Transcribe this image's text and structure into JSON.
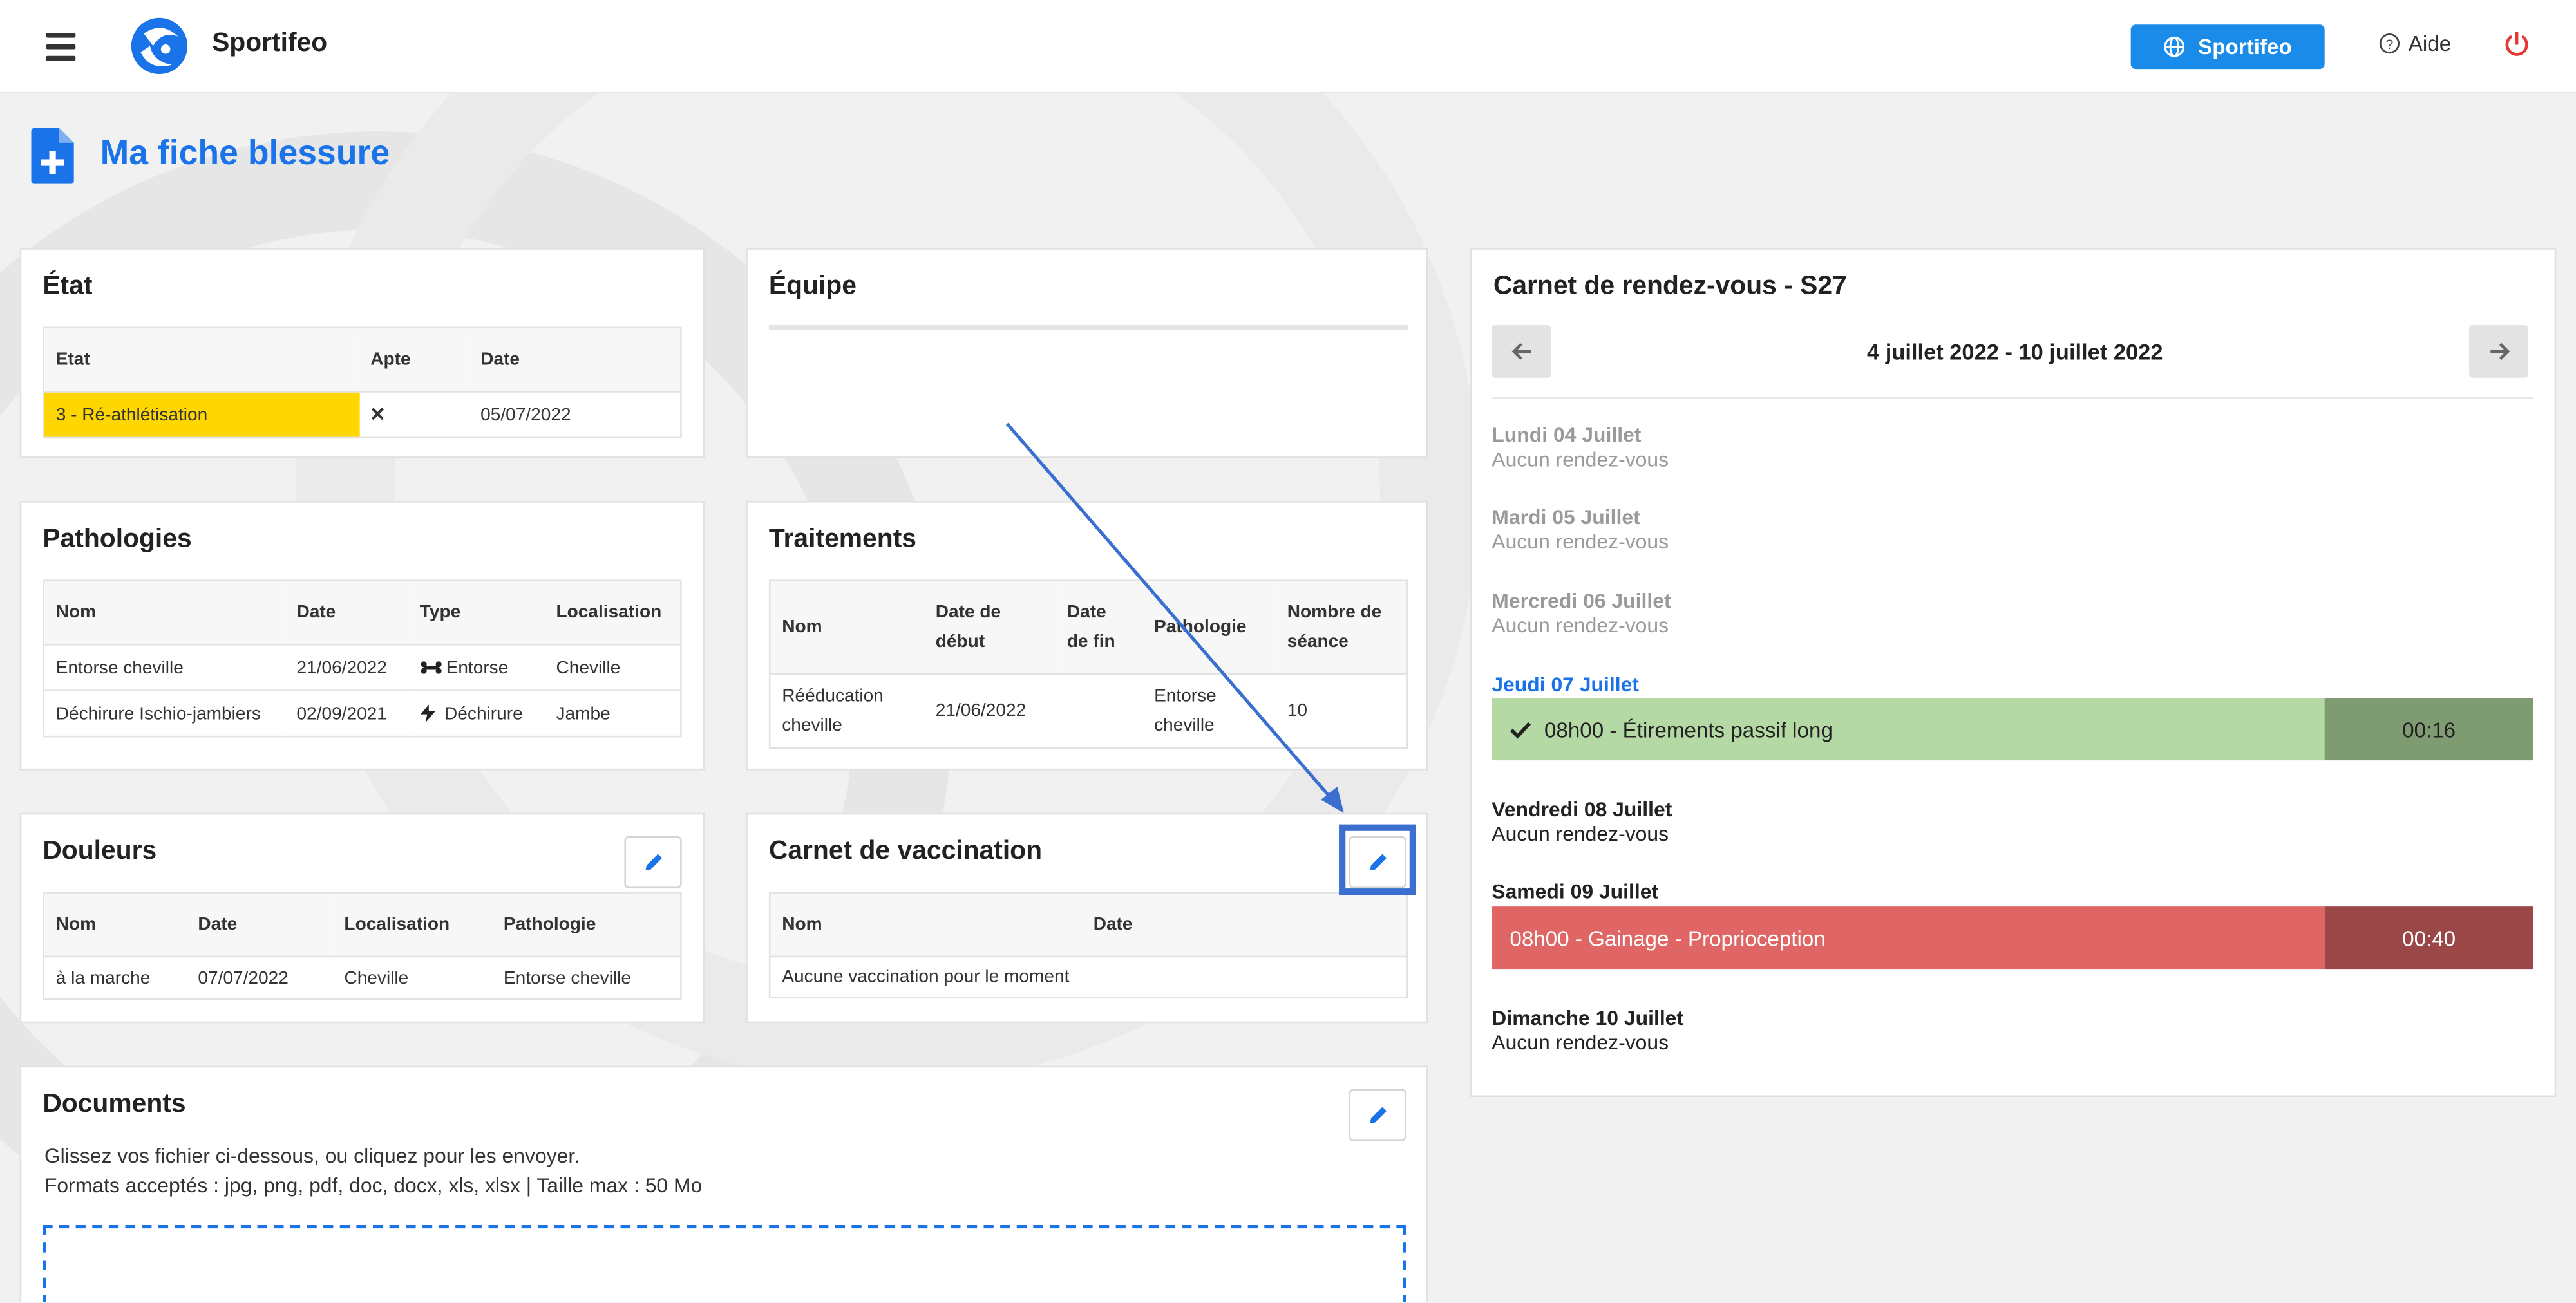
{
  "topbar": {
    "brand": "Sportifeo",
    "sportifeo_button": "Sportifeo",
    "help_label": "Aide"
  },
  "page": {
    "title": "Ma fiche blessure"
  },
  "etat": {
    "title": "État",
    "headers": [
      "Etat",
      "Apte",
      "Date"
    ],
    "row": {
      "etat": "3 - Ré-athlétisation",
      "apte": "×",
      "date": "05/07/2022",
      "highlight_color": "#ffd700"
    }
  },
  "equipe": {
    "title": "Équipe"
  },
  "pathologies": {
    "title": "Pathologies",
    "headers": [
      "Nom",
      "Date",
      "Type",
      "Localisation"
    ],
    "rows": [
      {
        "nom": "Entorse cheville",
        "date": "21/06/2022",
        "type": "Entorse",
        "type_icon": "bone-icon",
        "localisation": "Cheville"
      },
      {
        "nom": "Déchirure Ischio-jambiers",
        "date": "02/09/2021",
        "type": "Déchirure",
        "type_icon": "lightning-icon",
        "localisation": "Jambe"
      }
    ]
  },
  "traitements": {
    "title": "Traitements",
    "headers": [
      "Nom",
      "Date de début",
      "Date de fin",
      "Pathologie",
      "Nombre de séance"
    ],
    "rows": [
      {
        "nom": "Rééducation cheville",
        "debut": "21/06/2022",
        "fin": "",
        "pathologie": "Entorse cheville",
        "seances": "10"
      }
    ]
  },
  "douleurs": {
    "title": "Douleurs",
    "headers": [
      "Nom",
      "Date",
      "Localisation",
      "Pathologie"
    ],
    "rows": [
      {
        "nom": "à la marche",
        "date": "07/07/2022",
        "localisation": "Cheville",
        "pathologie": "Entorse cheville"
      }
    ]
  },
  "vaccination": {
    "title": "Carnet de vaccination",
    "headers": [
      "Nom",
      "Date"
    ],
    "empty": "Aucune vaccination pour le moment"
  },
  "documents": {
    "title": "Documents",
    "line1": "Glissez vos fichier ci-dessous, ou cliquez pour les envoyer.",
    "line2": "Formats acceptés : jpg, png, pdf, doc, docx, xls, xlsx | Taille max : 50 Mo"
  },
  "carnet": {
    "title": "Carnet de rendez-vous - S27",
    "range": "4 juillet 2022 - 10 juillet 2022",
    "days": [
      {
        "name": "Lundi 04 Juillet",
        "sub": "Aucun rendez-vous"
      },
      {
        "name": "Mardi 05 Juillet",
        "sub": "Aucun rendez-vous"
      },
      {
        "name": "Mercredi 06 Juillet",
        "sub": "Aucun rendez-vous"
      },
      {
        "name": "Jeudi 07 Juillet"
      },
      {
        "name": "Vendredi 08 Juillet",
        "sub": "Aucun rendez-vous"
      },
      {
        "name": "Samedi 09 Juillet"
      },
      {
        "name": "Dimanche 10 Juillet",
        "sub": "Aucun rendez-vous"
      }
    ],
    "appointments": [
      {
        "label": "08h00 - Étirements passif long",
        "duration": "00:16",
        "status": "done",
        "color": "#b5d9a5",
        "dur_color": "#7e9b72"
      },
      {
        "label": "08h00 - Gainage - Proprioception",
        "duration": "00:40",
        "status": "late",
        "color": "#e06666",
        "dur_color": "#9c4747"
      }
    ]
  },
  "colors": {
    "accent": "#1a73e8",
    "button": "#1a8be8",
    "power": "#e53935"
  }
}
